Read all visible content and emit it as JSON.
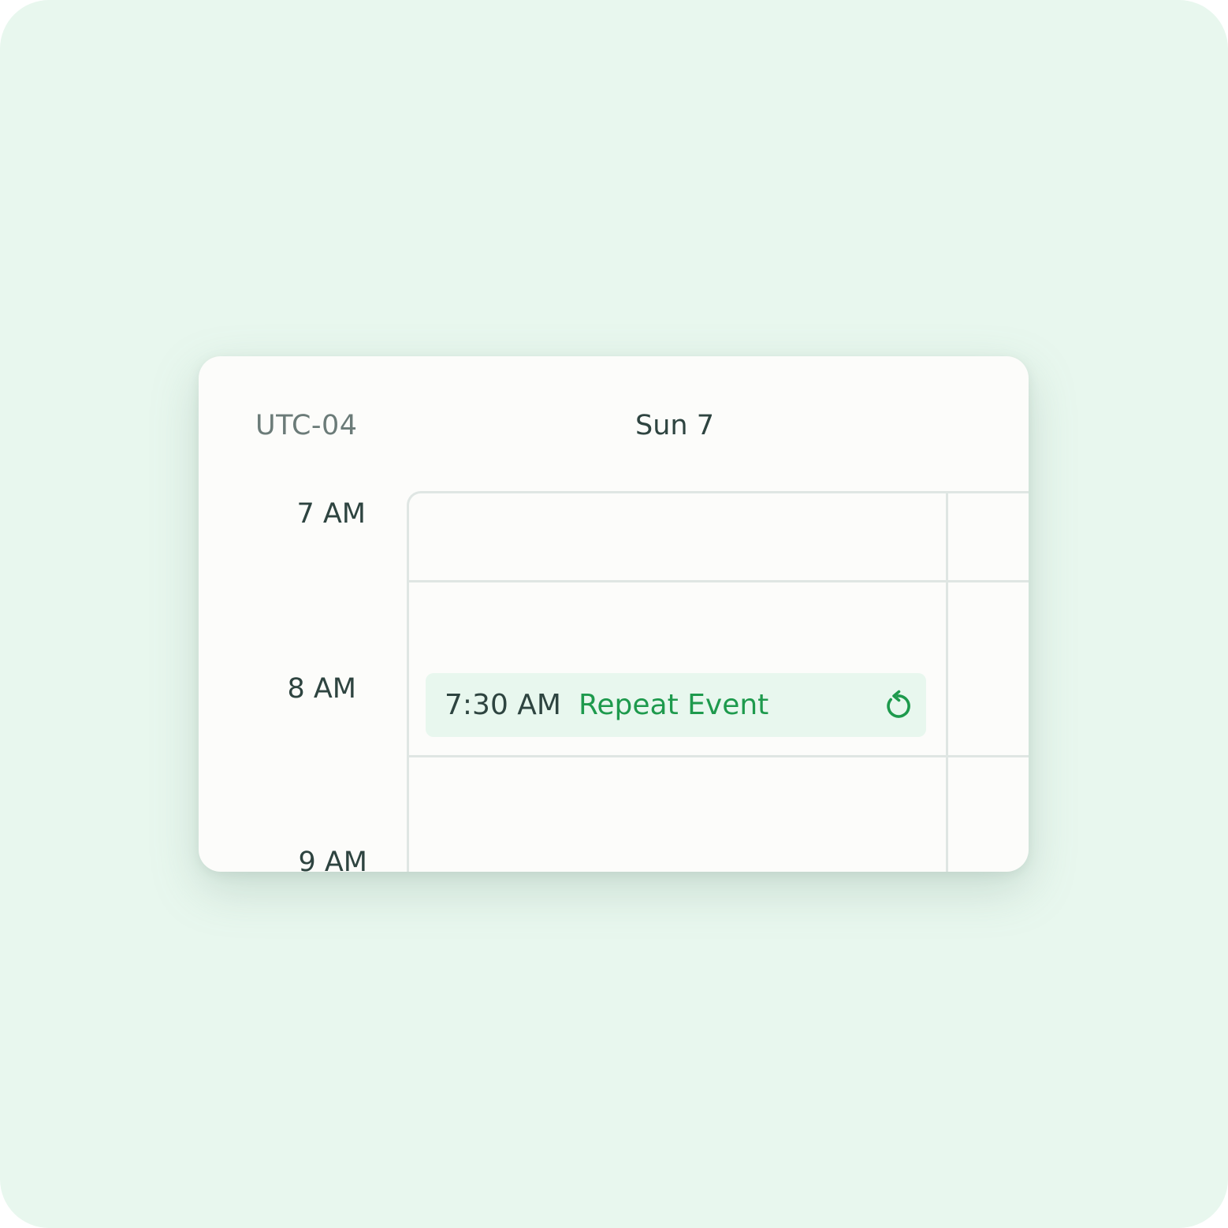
{
  "timezone_label": "UTC-04",
  "day_header": "Sun 7",
  "hour_labels": [
    "7 AM",
    "8 AM",
    "9 AM"
  ],
  "event": {
    "time": "7:30 AM",
    "title": "Repeat Event",
    "icon": "repeat-icon"
  },
  "colors": {
    "background": "#e8f7ee",
    "card": "#fcfcfa",
    "accent": "#1e9a4d",
    "text": "#2e4440",
    "muted_text": "#6b7b78",
    "gridline": "#dfe6e3"
  }
}
